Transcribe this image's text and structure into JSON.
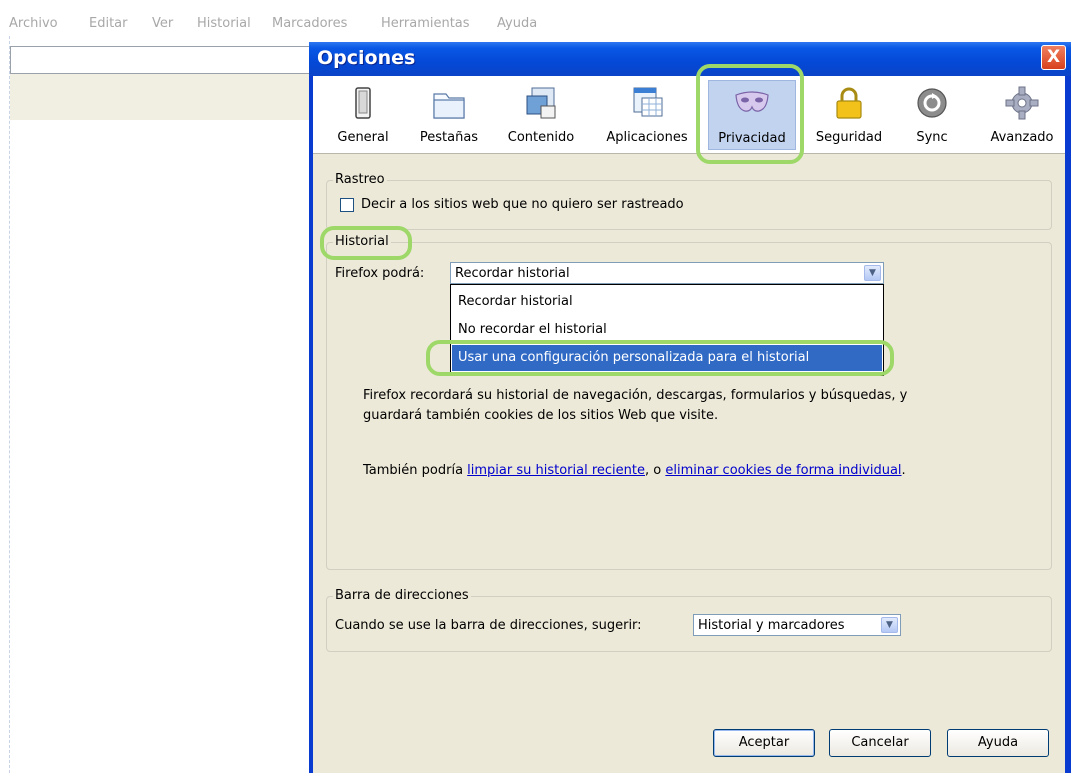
{
  "browser": {
    "menu": [
      "Archivo",
      "Editar",
      "Ver",
      "Historial",
      "Marcadores",
      "Herramientas",
      "Ayuda"
    ]
  },
  "dialog": {
    "title": "Opciones",
    "close": "X",
    "toolbar": [
      {
        "label": "General",
        "icon": "switch-icon"
      },
      {
        "label": "Pestañas",
        "icon": "tabs-icon"
      },
      {
        "label": "Contenido",
        "icon": "content-icon"
      },
      {
        "label": "Aplicaciones",
        "icon": "applications-icon"
      },
      {
        "label": "Privacidad",
        "icon": "mask-icon",
        "selected": true
      },
      {
        "label": "Seguridad",
        "icon": "lock-icon"
      },
      {
        "label": "Sync",
        "icon": "sync-icon"
      },
      {
        "label": "Avanzado",
        "icon": "gear-icon"
      }
    ],
    "tracking": {
      "legend": "Rastreo",
      "checkbox_label": "Decir a los sitios web que no quiero ser rastreado",
      "checked": false
    },
    "history": {
      "legend": "Historial",
      "firefox_label": "Firefox podrá:",
      "selected": "Recordar historial",
      "options": [
        "Recordar historial",
        "No recordar el historial",
        "Usar una configuración personalizada para el historial"
      ],
      "highlighted_index": 2,
      "desc_line1": "Firefox recordará su historial de navegación, descargas, formularios y búsquedas, y",
      "desc_line2": "guardará también cookies de los sitios Web que visite.",
      "also_prefix": "También podría ",
      "link_clear": "limpiar su historial reciente",
      "also_middle": ", o ",
      "link_cookies": "eliminar cookies de forma individual",
      "also_suffix": "."
    },
    "address_bar": {
      "legend": "Barra de direcciones",
      "label": "Cuando se use la barra de direcciones, sugerir:",
      "selected": "Historial y marcadores"
    },
    "buttons": {
      "ok": "Aceptar",
      "cancel": "Cancelar",
      "help": "Ayuda"
    },
    "colors": {
      "titlebar": "#0a58e6",
      "selection": "#316ac5",
      "highlight_ring": "#9ed869",
      "face": "#ece9d8"
    }
  }
}
